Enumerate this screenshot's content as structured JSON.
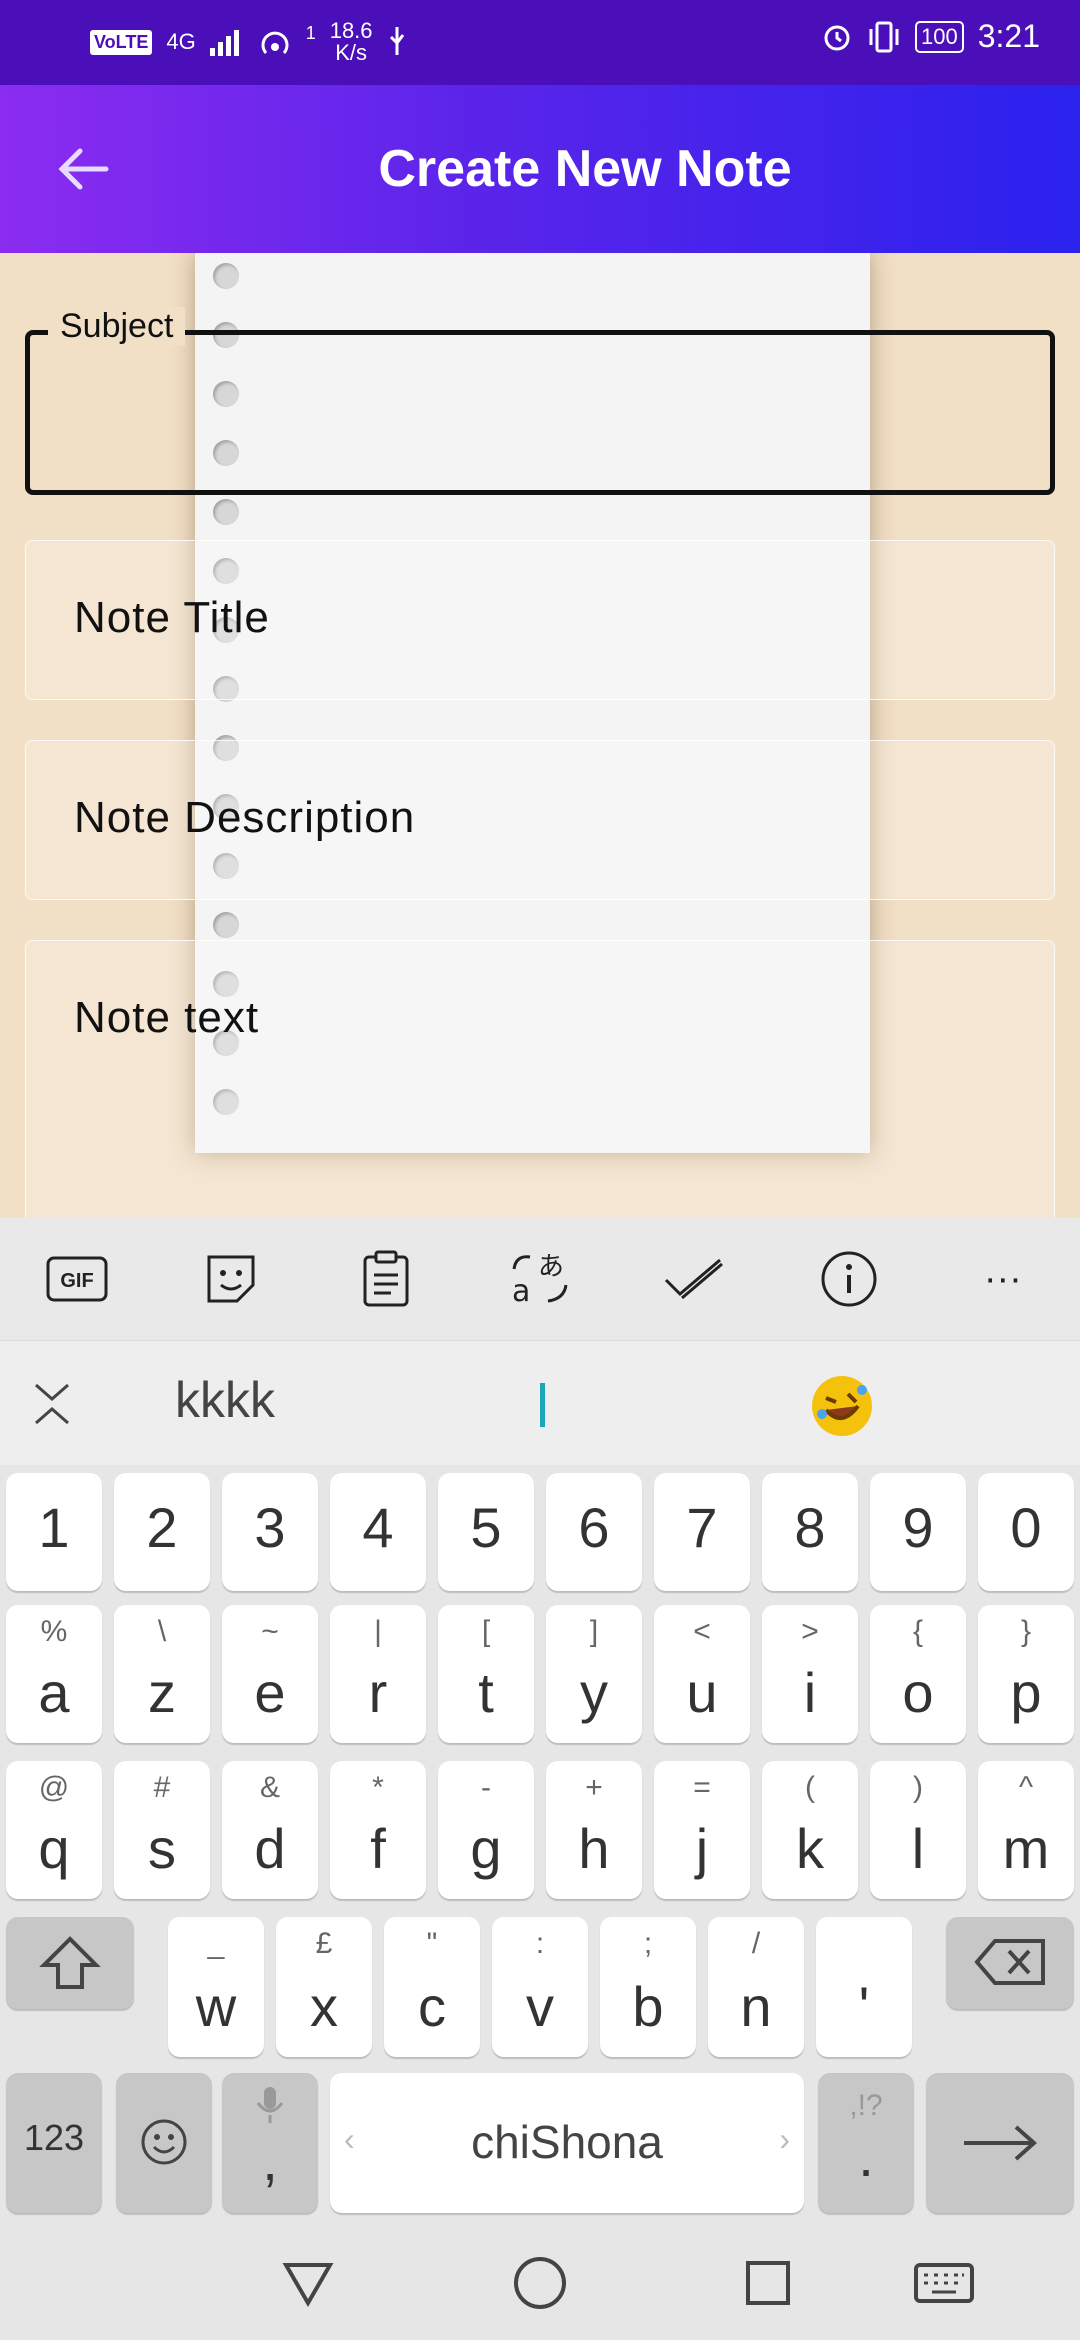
{
  "status_bar": {
    "volte": "VoLTE",
    "network": "4G",
    "speed_value": "18.6",
    "speed_unit": "K/s",
    "speed_sup": "1",
    "battery": "100",
    "time": "3:21"
  },
  "app_bar": {
    "title": "Create New Note"
  },
  "form": {
    "subject_label": "Subject",
    "subject_value": "",
    "title_placeholder": "Note Title",
    "description_placeholder": "Note Description",
    "text_placeholder": "Note text"
  },
  "keyboard_toolbar": {
    "gif_label": "GIF",
    "more_label": "···"
  },
  "suggestions": {
    "word": "kkkk"
  },
  "keyboard": {
    "number_row": [
      "1",
      "2",
      "3",
      "4",
      "5",
      "6",
      "7",
      "8",
      "9",
      "0"
    ],
    "row1": [
      {
        "main": "a",
        "alt": "%"
      },
      {
        "main": "z",
        "alt": "\\"
      },
      {
        "main": "e",
        "alt": "~"
      },
      {
        "main": "r",
        "alt": "|"
      },
      {
        "main": "t",
        "alt": "["
      },
      {
        "main": "y",
        "alt": "]"
      },
      {
        "main": "u",
        "alt": "<"
      },
      {
        "main": "i",
        "alt": ">"
      },
      {
        "main": "o",
        "alt": "{"
      },
      {
        "main": "p",
        "alt": "}"
      }
    ],
    "row2": [
      {
        "main": "q",
        "alt": "@"
      },
      {
        "main": "s",
        "alt": "#"
      },
      {
        "main": "d",
        "alt": "&"
      },
      {
        "main": "f",
        "alt": "*"
      },
      {
        "main": "g",
        "alt": "-"
      },
      {
        "main": "h",
        "alt": "+"
      },
      {
        "main": "j",
        "alt": "="
      },
      {
        "main": "k",
        "alt": "("
      },
      {
        "main": "l",
        "alt": ")"
      },
      {
        "main": "m",
        "alt": "^"
      }
    ],
    "row3": [
      {
        "main": "w",
        "alt": "_"
      },
      {
        "main": "x",
        "alt": "£"
      },
      {
        "main": "c",
        "alt": "\""
      },
      {
        "main": "v",
        "alt": ":"
      },
      {
        "main": "b",
        "alt": ";"
      },
      {
        "main": "n",
        "alt": "/"
      },
      {
        "main": "'",
        "alt": ""
      }
    ],
    "symbols_label": "123",
    "comma_label": ",",
    "space_label": "chiShona",
    "period_label": ".",
    "period_alt": ",!?"
  },
  "colors": {
    "status_bar": "#4a0fb8",
    "app_bar_start": "#8b2cf0",
    "app_bar_end": "#2b22ee",
    "cursor": "#1aa7b7"
  }
}
